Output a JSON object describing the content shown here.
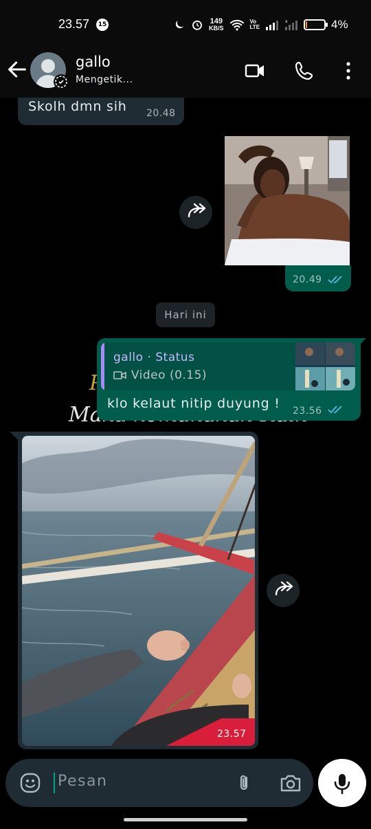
{
  "status_bar": {
    "time": "23.57",
    "notification_count": "15",
    "net_speed_value": "149",
    "net_speed_unit": "KB/S",
    "volte_top": "Vo",
    "volte_bottom": "LTE",
    "battery_percent": "4%",
    "battery_level": 0.04
  },
  "header": {
    "contact_name": "gallo",
    "contact_status": "Mengetik...",
    "icons": [
      "back-arrow-icon",
      "video-call-icon",
      "voice-call-icon",
      "more-options-icon"
    ]
  },
  "messages": [
    {
      "direction": "incoming",
      "text": "Skolh dmn sih",
      "time": "20.48"
    },
    {
      "direction": "outgoing",
      "type": "image",
      "time": "20.49",
      "status": "read"
    }
  ],
  "date_separator": "Hari ini",
  "reply_message": {
    "quote_author": "gallo · Status",
    "quote_preview": "Video (0.15)",
    "text": "klo kelaut nitip duyung !",
    "time": "23.56",
    "status": "read"
  },
  "incoming_photo": {
    "time": "23.57"
  },
  "wallpaper_text": {
    "line1": "P",
    "line2": "Maka kemanakah Raih"
  },
  "input": {
    "placeholder": "Pesan",
    "icons": [
      "emoji-icon",
      "attach-icon",
      "camera-icon",
      "mic-icon"
    ]
  },
  "colors": {
    "outgoing_bubble": "#005c4b",
    "incoming_bubble": "#202c33",
    "read_ticks": "#53bdeb",
    "accent": "#00a884"
  }
}
